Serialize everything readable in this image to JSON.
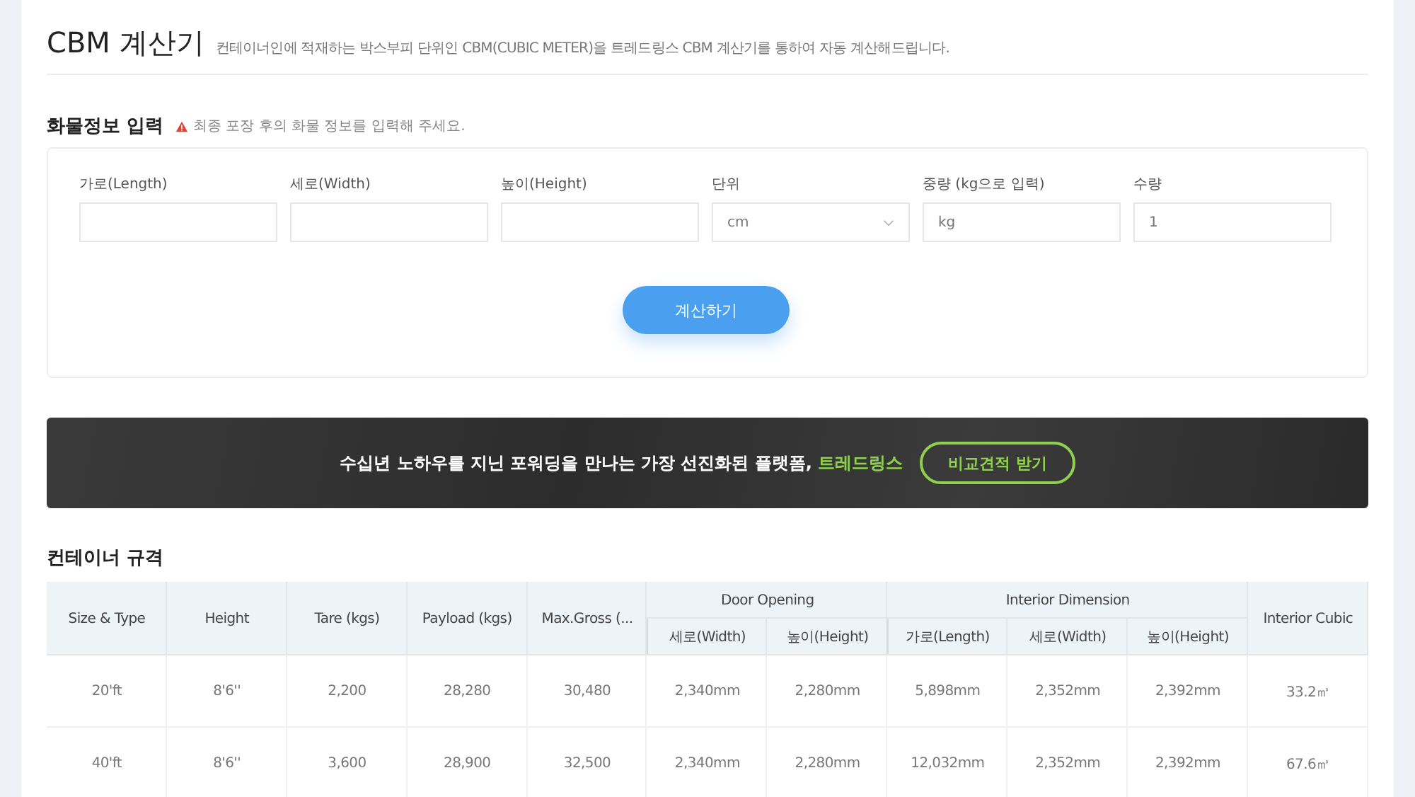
{
  "header": {
    "title": "CBM 계산기",
    "subtitle": "컨테이너인에 적재하는 박스부피 단위인 CBM(CUBIC METER)을 트레드링스 CBM 계산기를 통하여 자동 계산해드립니다."
  },
  "cargo_form": {
    "title": "화물정보 입력",
    "notice": "최종 포장 후의 화물 정보를 입력해 주세요.",
    "fields": [
      {
        "kind": "text",
        "label": "가로(Length)"
      },
      {
        "kind": "text",
        "label": "세로(Width)"
      },
      {
        "kind": "text",
        "label": "높이(Height)"
      },
      {
        "kind": "select",
        "label": "단위",
        "value": "cm"
      },
      {
        "kind": "text",
        "label": "중량 (kg으로 입력)",
        "placeholder": "kg"
      },
      {
        "kind": "text",
        "label": "수량",
        "value": "1"
      }
    ],
    "button": "계산하기"
  },
  "banner": {
    "text": "수십년 노하우를 지닌 포워딩을 만나는 가장 선진화된 플랫폼,",
    "highlight": "트레드링스",
    "button": "비교견적 받기"
  },
  "container_specs": {
    "title": "컨테이너 규격",
    "column_groups": [
      "Door Opening",
      "Interior Dimension"
    ],
    "columns": [
      {
        "label": "Size & Type",
        "grouped": false,
        "group_start": false
      },
      {
        "label": "Height",
        "grouped": false,
        "group_start": false
      },
      {
        "label": "Tare (kgs)",
        "grouped": false,
        "group_start": false
      },
      {
        "label": "Payload (kgs)",
        "grouped": false,
        "group_start": false
      },
      {
        "label": "Max.Gross (...",
        "grouped": false,
        "group_start": false
      },
      {
        "label": "세로(Width)",
        "grouped": true,
        "group_start": true
      },
      {
        "label": "높이(Height)",
        "grouped": true,
        "group_start": false
      },
      {
        "label": "가로(Length)",
        "grouped": true,
        "group_start": true
      },
      {
        "label": "세로(Width)",
        "grouped": true,
        "group_start": false
      },
      {
        "label": "높이(Height)",
        "grouped": true,
        "group_start": false
      },
      {
        "label": "Interior Cubic",
        "grouped": false,
        "group_start": false
      }
    ],
    "rows": [
      [
        "20'ft",
        "8'6''",
        "2,200",
        "28,280",
        "30,480",
        "2,340mm",
        "2,280mm",
        "5,898mm",
        "2,352mm",
        "2,392mm",
        "33.2㎥"
      ],
      [
        "40'ft",
        "8'6''",
        "3,600",
        "28,900",
        "32,500",
        "2,340mm",
        "2,280mm",
        "12,032mm",
        "2,352mm",
        "2,392mm",
        "67.6㎥"
      ]
    ]
  }
}
